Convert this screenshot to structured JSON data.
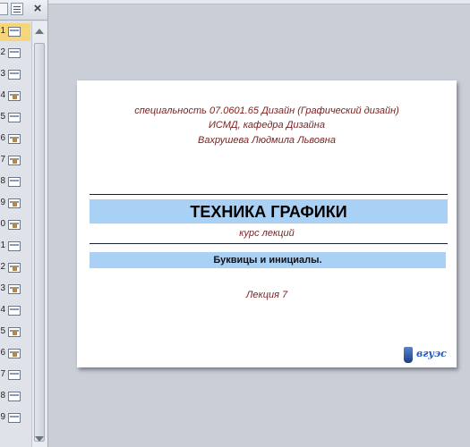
{
  "panel": {
    "close_label": "×",
    "slides": [
      {
        "num": "1",
        "active": true
      },
      {
        "num": "2"
      },
      {
        "num": "3"
      },
      {
        "num": "4"
      },
      {
        "num": "5"
      },
      {
        "num": "6"
      },
      {
        "num": "7"
      },
      {
        "num": "8"
      },
      {
        "num": "9"
      },
      {
        "num": "10"
      },
      {
        "num": "11"
      },
      {
        "num": "12"
      },
      {
        "num": "13"
      },
      {
        "num": "14"
      },
      {
        "num": "15"
      },
      {
        "num": "16"
      },
      {
        "num": "17"
      },
      {
        "num": "18"
      },
      {
        "num": "19"
      }
    ]
  },
  "slide": {
    "specialty": "специальность 07.0601.65 Дизайн (Графический дизайн)",
    "department": "ИСМД, кафедра Дизайна",
    "author": "Вахрушева Людмила Львовна",
    "title": "ТЕХНИКА ГРАФИКИ",
    "subtitle": "курс лекций",
    "topic": "Буквицы и инициалы.",
    "lecture": "Лекция 7",
    "logo_text": "вгуэс"
  },
  "colors": {
    "band": "#a9d0f5",
    "intro_text": "#7a1e1e",
    "logo": "#1f58c0"
  }
}
